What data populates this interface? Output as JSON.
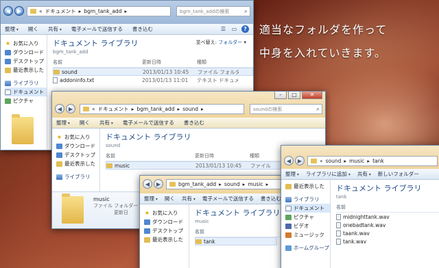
{
  "caption": {
    "line1": "適当なフォルダを作って",
    "line2": "中身を入れていきます。"
  },
  "windows": {
    "w1": {
      "addr": [
        "«",
        "ドキュメント",
        "▸",
        "bgm_tank_add",
        "▸"
      ],
      "search_placeholder": "bgm_tank_addの検索",
      "toolbar": [
        "整理",
        "開く",
        "共有",
        "電子メールで送信する",
        "書き込む"
      ],
      "sidebar": [
        "お気に入り",
        "ダウンロード",
        "デスクトップ",
        "最近表示した",
        "ライブラリ",
        "ドキュメント",
        "ピクチャ"
      ],
      "library_title": "ドキュメント ライブラリ",
      "library_sub": "bgm_tank_add",
      "arrange_label": "並べ替え:",
      "arrange_value": "フォルダー",
      "columns": [
        "名前",
        "更新日時",
        "種類"
      ],
      "rows": [
        {
          "name": "sound",
          "date": "2013/01/13 10:45",
          "type": "ファイル フォルダー"
        },
        {
          "name": "addoninfo.txt",
          "date": "2013/01/13 11:01",
          "type": "テキスト ドキュメント"
        }
      ]
    },
    "w2": {
      "addr": [
        "«",
        "ドキュメント",
        "▸",
        "bgm_tank_add",
        "▸",
        "sound",
        "▸"
      ],
      "search_placeholder": "soundの検索",
      "toolbar": [
        "整理",
        "開く",
        "共有",
        "電子メールで送信する",
        "書き込む"
      ],
      "sidebar": [
        "お気に入り",
        "ダウンロード",
        "デスクトップ",
        "最近表示した",
        "ライブラリ"
      ],
      "library_title": "ドキュメント ライブラリ",
      "library_sub": "sound",
      "columns": [
        "名前",
        "更新日時",
        "種類"
      ],
      "rows": [
        {
          "name": "music",
          "date": "2013/01/13 10:45",
          "type": "ファイル"
        }
      ],
      "detail_name": "music",
      "detail_type": "ファイル フォルダー",
      "detail_extra": "更新日"
    },
    "w3": {
      "addr": [
        "bgm_tank_add",
        "▸",
        "sound",
        "▸",
        "music",
        "▸"
      ],
      "toolbar": [
        "整理",
        "開く",
        "共有",
        "電子メールで送信する",
        "書き込む"
      ],
      "sidebar": [
        "お気に入り",
        "ダウンロード",
        "デスクトップ",
        "最近表示した"
      ],
      "library_title": "ドキュメント ライブラリ",
      "library_sub": "music",
      "columns": [
        "名前"
      ],
      "rows": [
        {
          "name": "tank"
        }
      ]
    },
    "w4": {
      "addr": [
        "«",
        "sound",
        "▸",
        "music",
        "▸",
        "tank"
      ],
      "toolbar": [
        "整理",
        "ライブラリに追加",
        "共有",
        "新しいフォルダー"
      ],
      "sidebar": [
        "最近表示した",
        "ライブラリ",
        "ドキュメント",
        "ピクチャ",
        "ビデオ",
        "ミュージック",
        "ホームグループ"
      ],
      "library_title": "ドキュメント ライブラリ",
      "library_sub": "tank",
      "columns": [
        "名前"
      ],
      "rows": [
        {
          "name": "midnighttank.wav"
        },
        {
          "name": "onebadtank.wav"
        },
        {
          "name": "taank.wav"
        },
        {
          "name": "tank.wav"
        }
      ]
    }
  }
}
